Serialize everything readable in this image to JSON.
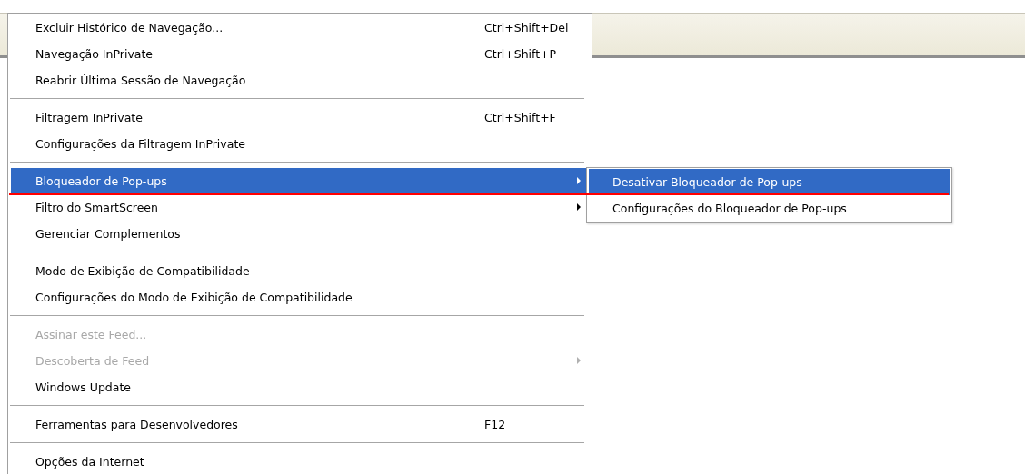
{
  "menu": {
    "groups": [
      [
        {
          "label": "Excluir Histórico de Navegação...",
          "shortcut": "Ctrl+Shift+Del",
          "disabled": false,
          "submenu": false,
          "selected": false
        },
        {
          "label": "Navegação InPrivate",
          "shortcut": "Ctrl+Shift+P",
          "disabled": false,
          "submenu": false,
          "selected": false
        },
        {
          "label": "Reabrir Última Sessão de Navegação",
          "disabled": false,
          "submenu": false,
          "selected": false
        }
      ],
      [
        {
          "label": "Filtragem InPrivate",
          "shortcut": "Ctrl+Shift+F",
          "disabled": false,
          "submenu": false,
          "selected": false
        },
        {
          "label": "Configurações da Filtragem InPrivate",
          "disabled": false,
          "submenu": false,
          "selected": false
        }
      ],
      [
        {
          "label": "Bloqueador de Pop-ups",
          "disabled": false,
          "submenu": true,
          "selected": true
        },
        {
          "label": "Filtro do SmartScreen",
          "disabled": false,
          "submenu": true,
          "selected": false
        },
        {
          "label": "Gerenciar Complementos",
          "disabled": false,
          "submenu": false,
          "selected": false
        }
      ],
      [
        {
          "label": "Modo de Exibição de Compatibilidade",
          "disabled": false,
          "submenu": false,
          "selected": false
        },
        {
          "label": "Configurações do Modo de Exibição de Compatibilidade",
          "disabled": false,
          "submenu": false,
          "selected": false
        }
      ],
      [
        {
          "label": "Assinar este Feed...",
          "disabled": true,
          "submenu": false,
          "selected": false
        },
        {
          "label": "Descoberta de Feed",
          "disabled": true,
          "submenu": true,
          "selected": false
        },
        {
          "label": "Windows Update",
          "disabled": false,
          "submenu": false,
          "selected": false
        }
      ],
      [
        {
          "label": "Ferramentas para Desenvolvedores",
          "shortcut": "F12",
          "disabled": false,
          "submenu": false,
          "selected": false
        }
      ],
      [
        {
          "label": "Opções da Internet",
          "disabled": false,
          "submenu": false,
          "selected": false
        }
      ]
    ]
  },
  "submenu": {
    "items": [
      {
        "label": "Desativar Bloqueador de Pop-ups",
        "selected": true
      },
      {
        "label": "Configurações do Bloqueador de Pop-ups",
        "selected": false
      }
    ]
  },
  "annotation_underline": true
}
